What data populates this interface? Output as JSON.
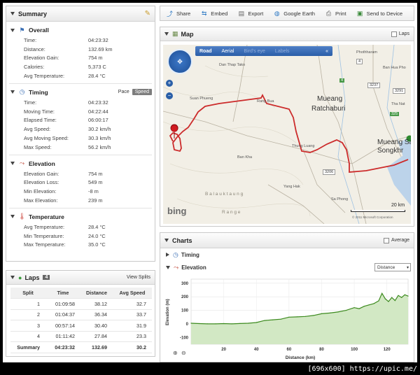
{
  "summary": {
    "title": "Summary",
    "overall": {
      "title": "Overall",
      "rows": [
        {
          "label": "Time:",
          "value": "04:23:32"
        },
        {
          "label": "Distance:",
          "value": "132.69 km"
        },
        {
          "label": "Elevation Gain:",
          "value": "754 m"
        },
        {
          "label": "Calories:",
          "value": "5,373 C"
        },
        {
          "label": "Avg Temperature:",
          "value": "28.4 °C"
        }
      ]
    },
    "timing": {
      "title": "Timing",
      "pace_label": "Pace",
      "speed_label": "Speed",
      "rows": [
        {
          "label": "Time:",
          "value": "04:23:32"
        },
        {
          "label": "Moving Time:",
          "value": "04:22:44"
        },
        {
          "label": "Elapsed Time:",
          "value": "06:00:17"
        },
        {
          "label": "Avg Speed:",
          "value": "30.2 km/h"
        },
        {
          "label": "Avg Moving Speed:",
          "value": "30.3 km/h"
        },
        {
          "label": "Max Speed:",
          "value": "56.2 km/h"
        }
      ]
    },
    "elevation": {
      "title": "Elevation",
      "rows": [
        {
          "label": "Elevation Gain:",
          "value": "754 m"
        },
        {
          "label": "Elevation Loss:",
          "value": "549 m"
        },
        {
          "label": "Min Elevation:",
          "value": "-8 m"
        },
        {
          "label": "Max Elevation:",
          "value": "239 m"
        }
      ]
    },
    "temperature": {
      "title": "Temperature",
      "rows": [
        {
          "label": "Avg Temperature:",
          "value": "28.4 °C"
        },
        {
          "label": "Min Temperature:",
          "value": "24.0 °C"
        },
        {
          "label": "Max Temperature:",
          "value": "35.0 °C"
        }
      ]
    }
  },
  "laps": {
    "title": "Laps",
    "count": "4",
    "view_splits": "View Splits",
    "headers": [
      "Split",
      "Time",
      "Distance",
      "Avg Speed"
    ],
    "rows": [
      [
        "1",
        "01:09:58",
        "38.12",
        "32.7"
      ],
      [
        "2",
        "01:04:37",
        "36.34",
        "33.7"
      ],
      [
        "3",
        "00:57:14",
        "30.40",
        "31.9"
      ],
      [
        "4",
        "01:11:42",
        "27.84",
        "23.3"
      ]
    ],
    "summary_row": [
      "Summary",
      "04:23:32",
      "132.69",
      "30.2"
    ]
  },
  "toolbar": {
    "share": "Share",
    "embed": "Embed",
    "export": "Export",
    "google_earth": "Google Earth",
    "print": "Print",
    "send": "Send to Device"
  },
  "map": {
    "title": "Map",
    "laps_label": "Laps",
    "modes": [
      "Road",
      "Aerial",
      "Bird's eye",
      "Labels"
    ],
    "collapse": "«",
    "places": [
      {
        "name": "Dan Thap Tako"
      },
      {
        "name": "Suan Phueng"
      },
      {
        "name": "Rang Bua"
      },
      {
        "name": "Mueang"
      },
      {
        "name": "Ratchaburi"
      },
      {
        "name": "Thung Luang"
      },
      {
        "name": "Ban Kha"
      },
      {
        "name": "Yang Hak"
      },
      {
        "name": "Phothharam"
      },
      {
        "name": "Ban Hua Pho"
      },
      {
        "name": "Tha Nat"
      },
      {
        "name": "Mueang Sa"
      },
      {
        "name": "Songkhr"
      },
      {
        "name": "Sa Phong"
      },
      {
        "name": "B a l a u k t a u n g"
      },
      {
        "name": "R a n g e"
      }
    ],
    "roads": [
      "4",
      "3237",
      "3291",
      "4",
      "3206",
      "325"
    ],
    "scale": "20 km",
    "provider": "bing",
    "copyright": "© 2011 Microsoft Corporation",
    "route_color": "#cc2b2b"
  },
  "charts": {
    "title": "Charts",
    "average_label": "Average",
    "timing_label": "Timing",
    "elevation_label": "Elevation",
    "dropdown": "Distance"
  },
  "chart_data": {
    "type": "area",
    "xlabel": "Distance (km)",
    "ylabel": "Elevation (m)",
    "xlim": [
      0,
      133
    ],
    "ylim": [
      -150,
      330
    ],
    "x_ticks": [
      20,
      40,
      60,
      80,
      100,
      120
    ],
    "y_ticks": [
      300,
      200,
      100,
      0,
      -100
    ],
    "x": [
      0,
      5,
      10,
      15,
      20,
      25,
      30,
      35,
      40,
      45,
      50,
      55,
      60,
      65,
      70,
      75,
      80,
      85,
      90,
      95,
      100,
      103,
      106,
      109,
      112,
      115,
      117,
      119,
      121,
      123,
      125,
      127,
      129,
      131,
      133
    ],
    "values": [
      5,
      2,
      0,
      0,
      2,
      0,
      3,
      5,
      10,
      25,
      30,
      35,
      50,
      52,
      55,
      62,
      75,
      80,
      88,
      100,
      120,
      112,
      130,
      140,
      150,
      170,
      225,
      185,
      165,
      195,
      172,
      210,
      195,
      215,
      205
    ],
    "color": "#3c8a1e",
    "fill": "#d2e8c4"
  },
  "watermark": "[696x600] https://upic.me/"
}
